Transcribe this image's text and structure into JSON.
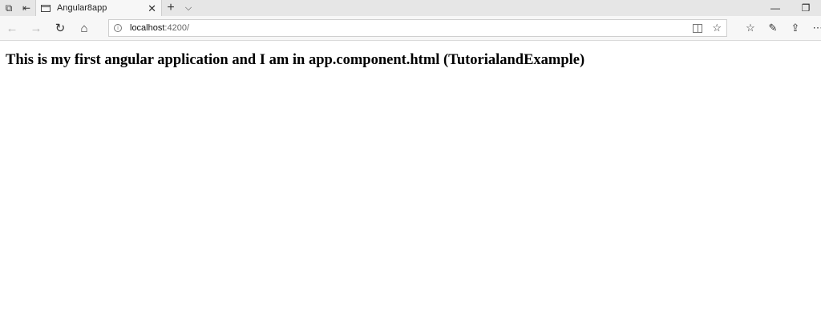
{
  "tab": {
    "title": "Angular8app",
    "close_glyph": "✕"
  },
  "newtab_glyph": "+",
  "tablist_glyph": "⌵",
  "window_controls": {
    "minimize": "—",
    "restore": "❐"
  },
  "address_bar": {
    "host": "localhost",
    "rest": ":4200/"
  },
  "page": {
    "heading": "This is my first angular application and I am in app.component.html (TutorialandExample)"
  },
  "icons": {
    "tabs_aside": "tabs-aside-icon",
    "set_aside": "set-tabs-aside-icon",
    "back": "back-icon",
    "forward": "forward-icon",
    "refresh": "refresh-icon",
    "home": "home-icon",
    "reading_view": "reading-view-icon",
    "favorite": "star-icon",
    "favorites_hub": "favorites-hub-icon",
    "notes": "pen-icon",
    "share": "share-icon",
    "more": "more-icon"
  }
}
